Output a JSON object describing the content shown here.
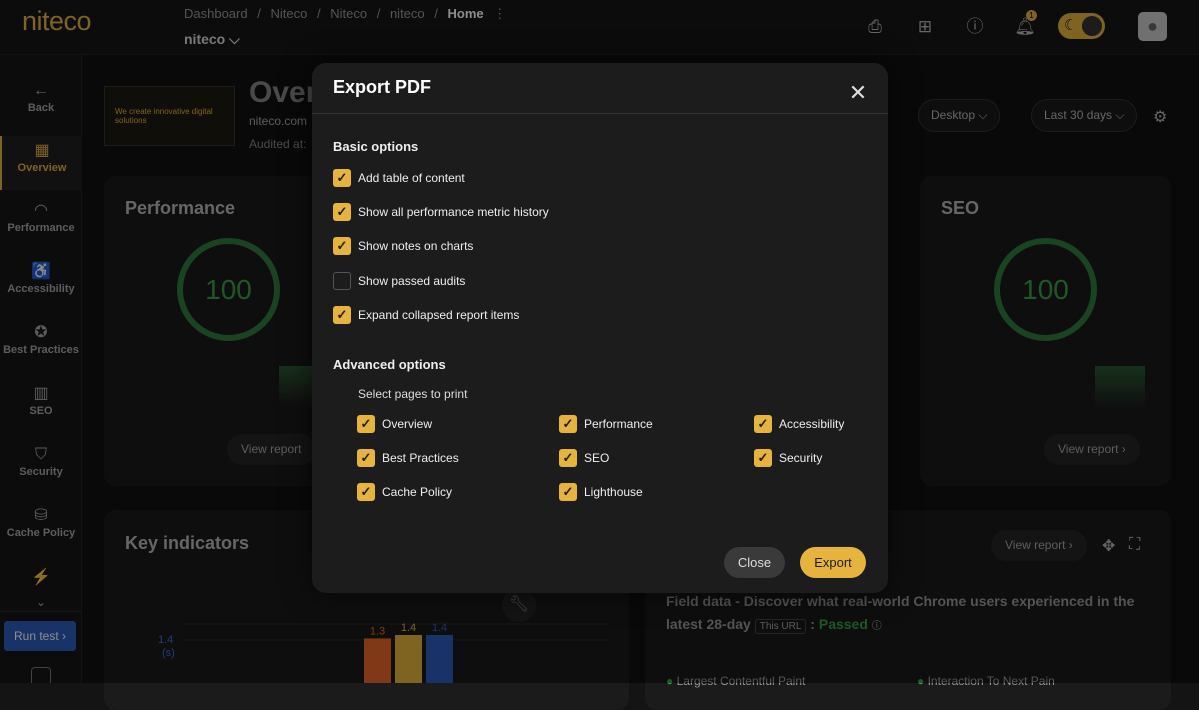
{
  "header": {
    "logo": "niteco",
    "breadcrumbs": [
      "Dashboard",
      "/",
      "Niteco",
      "/",
      "Niteco",
      "/",
      "niteco",
      "/",
      "Home",
      "⋮"
    ],
    "project": "niteco ⌵",
    "notification_count": "1"
  },
  "sidebar": {
    "items": [
      {
        "label": "Back",
        "icon": "←"
      },
      {
        "label": "Overview",
        "icon": "▦"
      },
      {
        "label": "Performance",
        "icon": "◠"
      },
      {
        "label": "Accessibility",
        "icon": "♿"
      },
      {
        "label": "Best Practices",
        "icon": "✪"
      },
      {
        "label": "SEO",
        "icon": "▥"
      },
      {
        "label": "Security",
        "icon": "⛉"
      },
      {
        "label": "Cache Policy",
        "icon": "⛁"
      },
      {
        "label": "",
        "icon": "⚡"
      }
    ],
    "more": "⌄",
    "run_test": "Run test ›"
  },
  "overview": {
    "title": "Over",
    "url": "niteco.com",
    "audited": "Audited at:",
    "thumb_text": "We create innovative digital solutions",
    "filters": [
      "Desktop ⌵",
      "Last 30 days ⌵"
    ]
  },
  "cards": {
    "performance": {
      "title": "Performance",
      "score": "100",
      "view": "View report"
    },
    "seo": {
      "title": "SEO",
      "score": "100",
      "view": "View report ›"
    },
    "key_indicators": {
      "title": "Key indicators"
    },
    "field_view": "View report ›"
  },
  "field_data": {
    "text": "Field data - Discover what real-world Chrome users experienced in the latest 28-day",
    "tag": "This URL",
    "status_prefix": ":",
    "status": "Passed",
    "metrics": [
      "Largest Contentful Paint",
      "Interaction To Next Pain"
    ]
  },
  "chart_data": {
    "type": "bar",
    "y_label": "1.4\n(s)",
    "values": [
      1.3,
      1.4,
      1.4
    ],
    "labels": [
      "1.3",
      "1.4",
      "1.4"
    ],
    "colors": [
      "#e8682a",
      "#e6b43c",
      "#2f5dbf"
    ]
  },
  "modal": {
    "title": "Export PDF",
    "basic_title": "Basic options",
    "basic": [
      {
        "label": "Add table of content",
        "checked": true
      },
      {
        "label": "Show all performance metric history",
        "checked": true
      },
      {
        "label": "Show notes on charts",
        "checked": true
      },
      {
        "label": "Show passed audits",
        "checked": false
      },
      {
        "label": "Expand collapsed report items",
        "checked": true
      }
    ],
    "advanced_title": "Advanced options",
    "select_pages": "Select pages to print",
    "pages": [
      {
        "label": "Overview",
        "checked": true
      },
      {
        "label": "Performance",
        "checked": true
      },
      {
        "label": "Accessibility",
        "checked": true
      },
      {
        "label": "Best Practices",
        "checked": true
      },
      {
        "label": "SEO",
        "checked": true
      },
      {
        "label": "Security",
        "checked": true
      },
      {
        "label": "Cache Policy",
        "checked": true
      },
      {
        "label": "Lighthouse",
        "checked": true
      }
    ],
    "close": "Close",
    "export": "Export"
  }
}
